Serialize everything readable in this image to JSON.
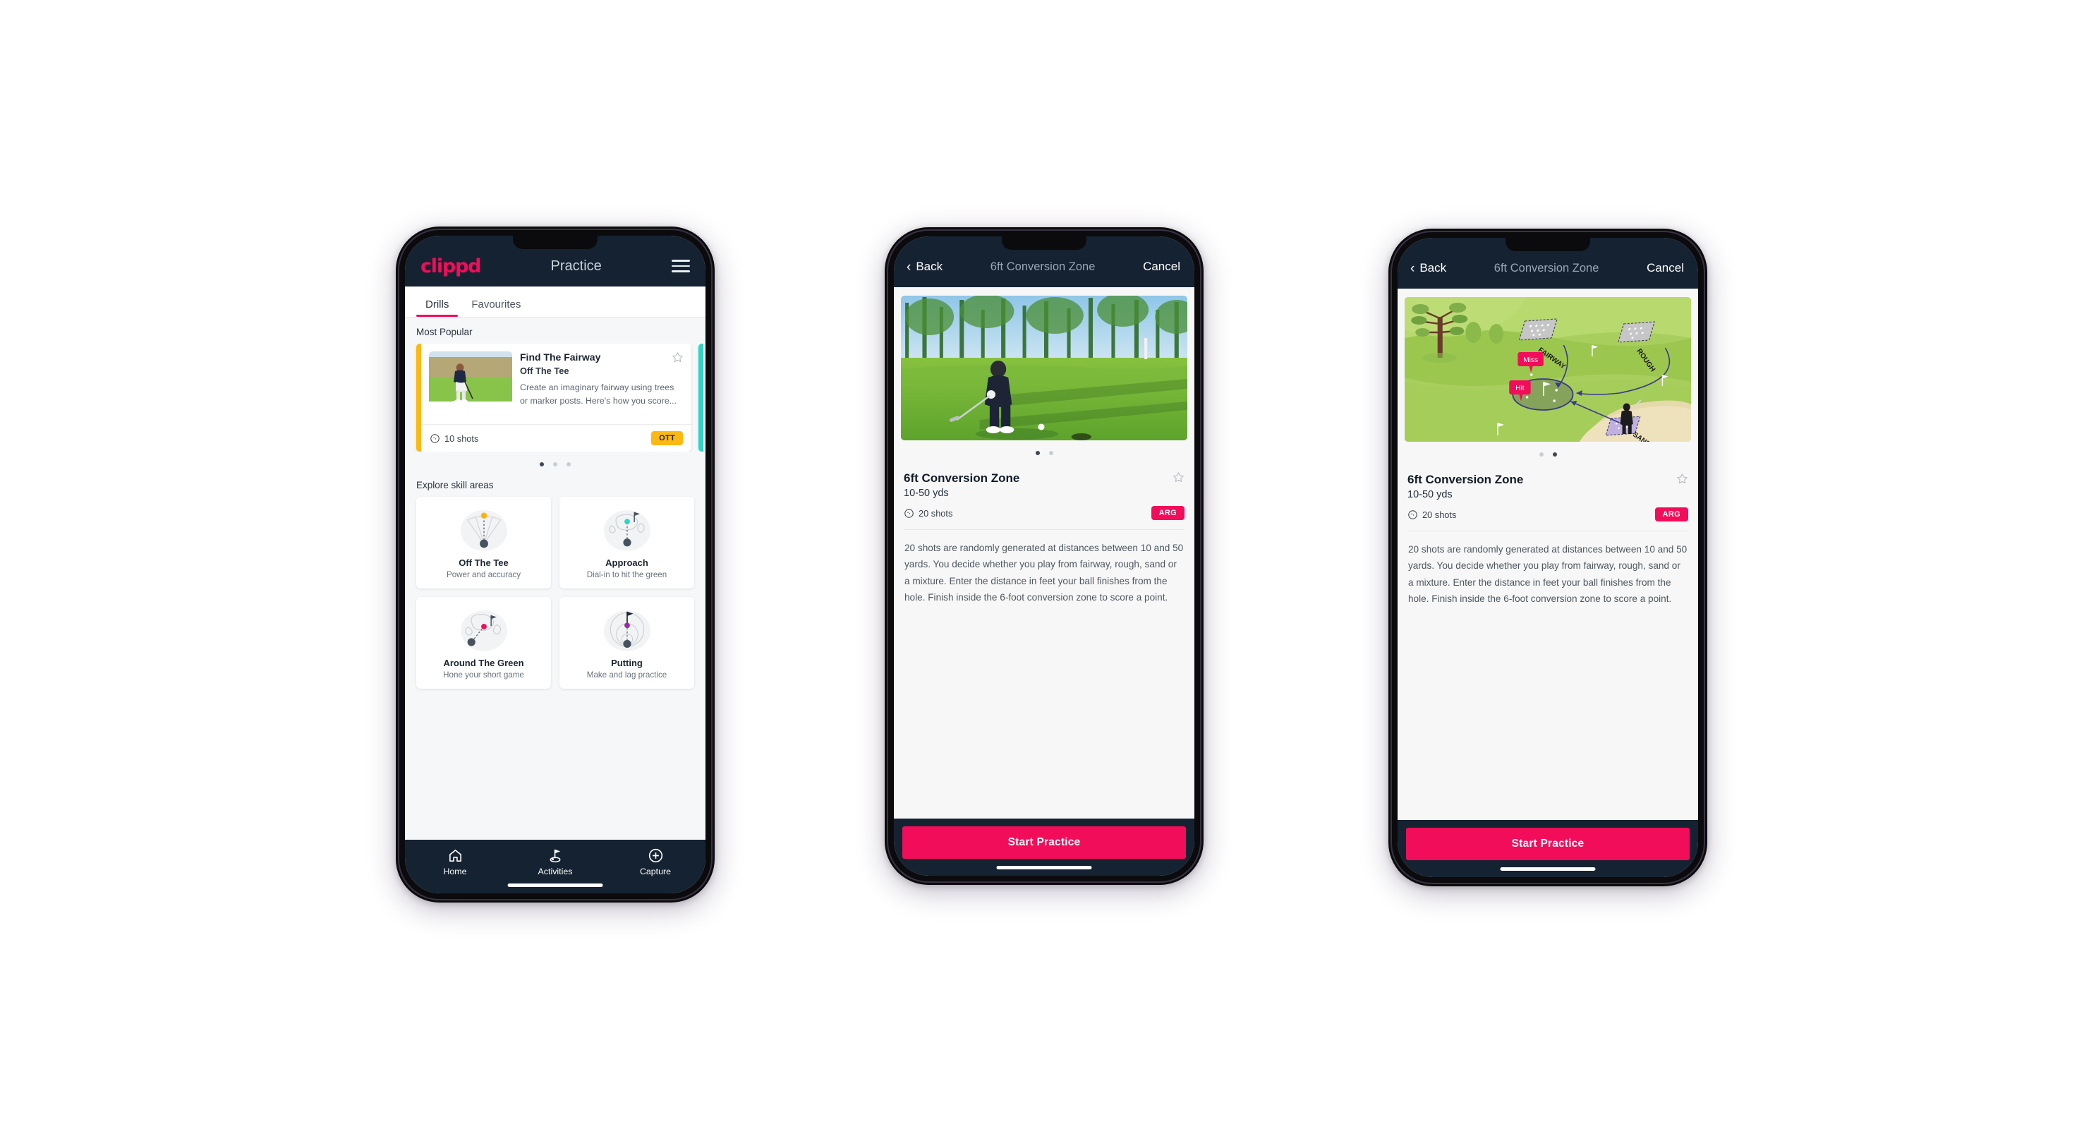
{
  "app": {
    "brand": "clippd",
    "accent_pink": "#F20D5A",
    "accent_amber": "#FCB813",
    "accent_teal": "#2CD5C4",
    "header_bg": "#152231"
  },
  "phone1": {
    "appbar": {
      "logo": "clippd",
      "title": "Practice",
      "menu_icon": "hamburger-icon"
    },
    "tabs": [
      {
        "label": "Drills",
        "active": true
      },
      {
        "label": "Favourites",
        "active": false
      }
    ],
    "most_popular": {
      "section_label": "Most Popular",
      "card": {
        "title": "Find The Fairway",
        "subtitle": "Off The Tee",
        "description": "Create an imaginary fairway using trees or marker posts. Here's how you score...",
        "shots": "10 shots",
        "badge": "OTT",
        "accent": "#FCB813",
        "favourite_icon": "star-outline-icon",
        "shots_icon": "clock-icon"
      },
      "dots": {
        "count": 3,
        "active_index": 0
      }
    },
    "skill_areas": {
      "section_label": "Explore skill areas",
      "items": [
        {
          "name": "Off The Tee",
          "desc": "Power and accuracy",
          "icon": "tee-dispersion-icon",
          "dot_color": "#FFB300"
        },
        {
          "name": "Approach",
          "desc": "Dial-in to hit the green",
          "icon": "approach-green-icon",
          "dot_color": "#2CD5C4"
        },
        {
          "name": "Around The Green",
          "desc": "Hone your short game",
          "icon": "chip-green-icon",
          "dot_color": "#F20D5A"
        },
        {
          "name": "Putting",
          "desc": "Make and lag practice",
          "icon": "putting-rings-icon",
          "dot_color": "#9C27B0"
        }
      ]
    },
    "bottom_nav": [
      {
        "label": "Home",
        "icon": "home-icon",
        "active": false
      },
      {
        "label": "Activities",
        "icon": "golf-flag-icon",
        "active": true
      },
      {
        "label": "Capture",
        "icon": "plus-circle-icon",
        "active": false
      }
    ]
  },
  "phone2": {
    "navbar": {
      "back": "Back",
      "title": "6ft Conversion Zone",
      "cancel": "Cancel",
      "back_icon": "chevron-left-icon"
    },
    "media": {
      "type": "photo",
      "alt": "golfer-putting-photo"
    },
    "dots": {
      "count": 2,
      "active_index": 0
    },
    "info": {
      "title": "6ft Conversion Zone",
      "subtitle": "10-50 yds",
      "shots": "20 shots",
      "badge": "ARG",
      "favourite_icon": "star-outline-icon",
      "shots_icon": "clock-icon"
    },
    "description": "20 shots are randomly generated at distances between 10 and 50 yards. You decide whether you play from fairway, rough, sand or a mixture. Enter the distance in feet your ball finishes from the hole. Finish inside the 6-foot conversion zone to score a point.",
    "cta": "Start Practice"
  },
  "phone3": {
    "navbar": {
      "back": "Back",
      "title": "6ft Conversion Zone",
      "cancel": "Cancel",
      "back_icon": "chevron-left-icon"
    },
    "media": {
      "type": "illustration",
      "alt": "golf-course-diagram",
      "labels": [
        "FAIRWAY",
        "ROUGH",
        "SAND"
      ],
      "markers": [
        "Miss",
        "Hit"
      ]
    },
    "dots": {
      "count": 2,
      "active_index": 1
    },
    "info": {
      "title": "6ft Conversion Zone",
      "subtitle": "10-50 yds",
      "shots": "20 shots",
      "badge": "ARG",
      "favourite_icon": "star-outline-icon",
      "shots_icon": "clock-icon"
    },
    "description": "20 shots are randomly generated at distances between 10 and 50 yards. You decide whether you play from fairway, rough, sand or a mixture. Enter the distance in feet your ball finishes from the hole. Finish inside the 6-foot conversion zone to score a point.",
    "cta": "Start Practice"
  }
}
